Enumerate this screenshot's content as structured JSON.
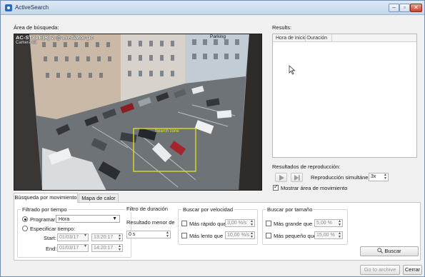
{
  "window": {
    "title": "ActiveSearch"
  },
  "search_area": {
    "label": "Área de búsqueda:",
    "video": {
      "camera_title": "AC-STYLE(R) 2 @ mediator-pc",
      "camera_sub": "Camera 01",
      "parking_label": "Parking",
      "zone_label": "Search zone"
    }
  },
  "results": {
    "label": "Results:",
    "columns": [
      "Hora de inicio",
      "Duración"
    ]
  },
  "playback": {
    "label": "Resultados de reproducción:",
    "simultaneous_label": "Reproducción simultánea:",
    "simultaneous_value": "3x",
    "show_area_label": "Mostrar área de movimiento",
    "show_area_checked": true
  },
  "tabs": [
    {
      "label": "Búsqueda por movimiento",
      "active": true
    },
    {
      "label": "Mapa de calor",
      "active": false
    }
  ],
  "time_filter": {
    "title": "Filtrado por tiempo",
    "schedule_label": "Programar:",
    "schedule_value": "Hora",
    "specify_label": "Especificar tiempo:",
    "start_label": "Start:",
    "start_date": "01/03/17",
    "start_time": "13:20:17",
    "end_label": "End:",
    "end_date": "01/03/17",
    "end_time": "14:20:17"
  },
  "duration_filter": {
    "title": "Filtro de duración",
    "min_label": "Resultado menor de",
    "min_value": "0 s"
  },
  "speed_filter": {
    "title": "Buscar por velocidad",
    "faster_label": "Más rápido que",
    "faster_value": "3,00 %/s",
    "slower_label": "Más lento que",
    "slower_value": "10,00 %/s"
  },
  "size_filter": {
    "title": "Buscar por tamaño",
    "bigger_label": "Más grande que",
    "bigger_value": "5,00 %",
    "smaller_label": "Más pequeño que",
    "smaller_value": "15,00 %"
  },
  "buttons": {
    "search": "Buscar",
    "go_to_archive": "Go to archive",
    "close": "Cerrar"
  }
}
